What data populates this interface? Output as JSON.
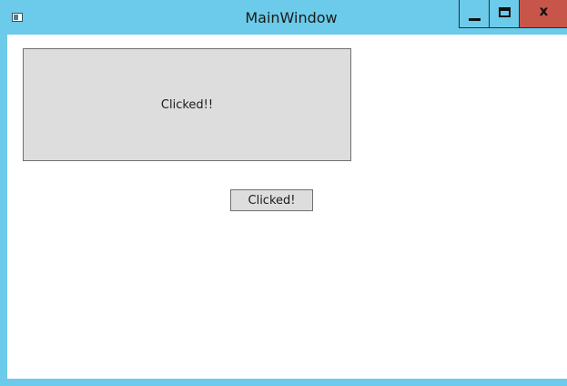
{
  "window": {
    "title": "MainWindow",
    "accent_color": "#6ccbea",
    "close_color": "#c8554a"
  },
  "titlebar": {
    "app_icon": "window-app-icon",
    "minimize_icon": "minimize-icon",
    "maximize_icon": "maximize-icon",
    "close_label": "x"
  },
  "content": {
    "large_button_label": "Clicked!!",
    "small_button_label": "Clicked!"
  }
}
